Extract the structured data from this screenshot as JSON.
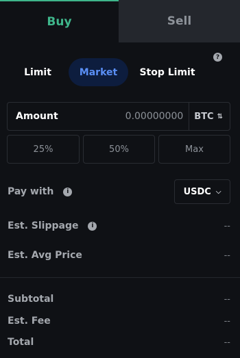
{
  "tabs": {
    "buy": "Buy",
    "sell": "Sell"
  },
  "help_icon": "?",
  "order_types": {
    "limit": "Limit",
    "market": "Market",
    "stop_limit": "Stop Limit"
  },
  "amount": {
    "label": "Amount",
    "value": "0.00000000",
    "unit": "BTC",
    "swap_icon": "⇅"
  },
  "percent_buttons": {
    "p25": "25%",
    "p50": "50%",
    "max": "Max"
  },
  "pay_with": {
    "label": "Pay with",
    "info": "i",
    "currency": "USDC",
    "chevron": "⌵"
  },
  "slippage": {
    "label": "Est. Slippage",
    "info": "i",
    "value": "--"
  },
  "avg_price": {
    "label": "Est. Avg Price",
    "value": "--"
  },
  "subtotal": {
    "label": "Subtotal",
    "value": "--"
  },
  "fee": {
    "label": "Est. Fee",
    "value": "--"
  },
  "total": {
    "label": "Total",
    "value": "--"
  },
  "colors": {
    "buy": "#3fb68b",
    "market_active_bg": "#0d1d3e",
    "market_active_text": "#5a8ff5",
    "background": "#0f1115"
  }
}
